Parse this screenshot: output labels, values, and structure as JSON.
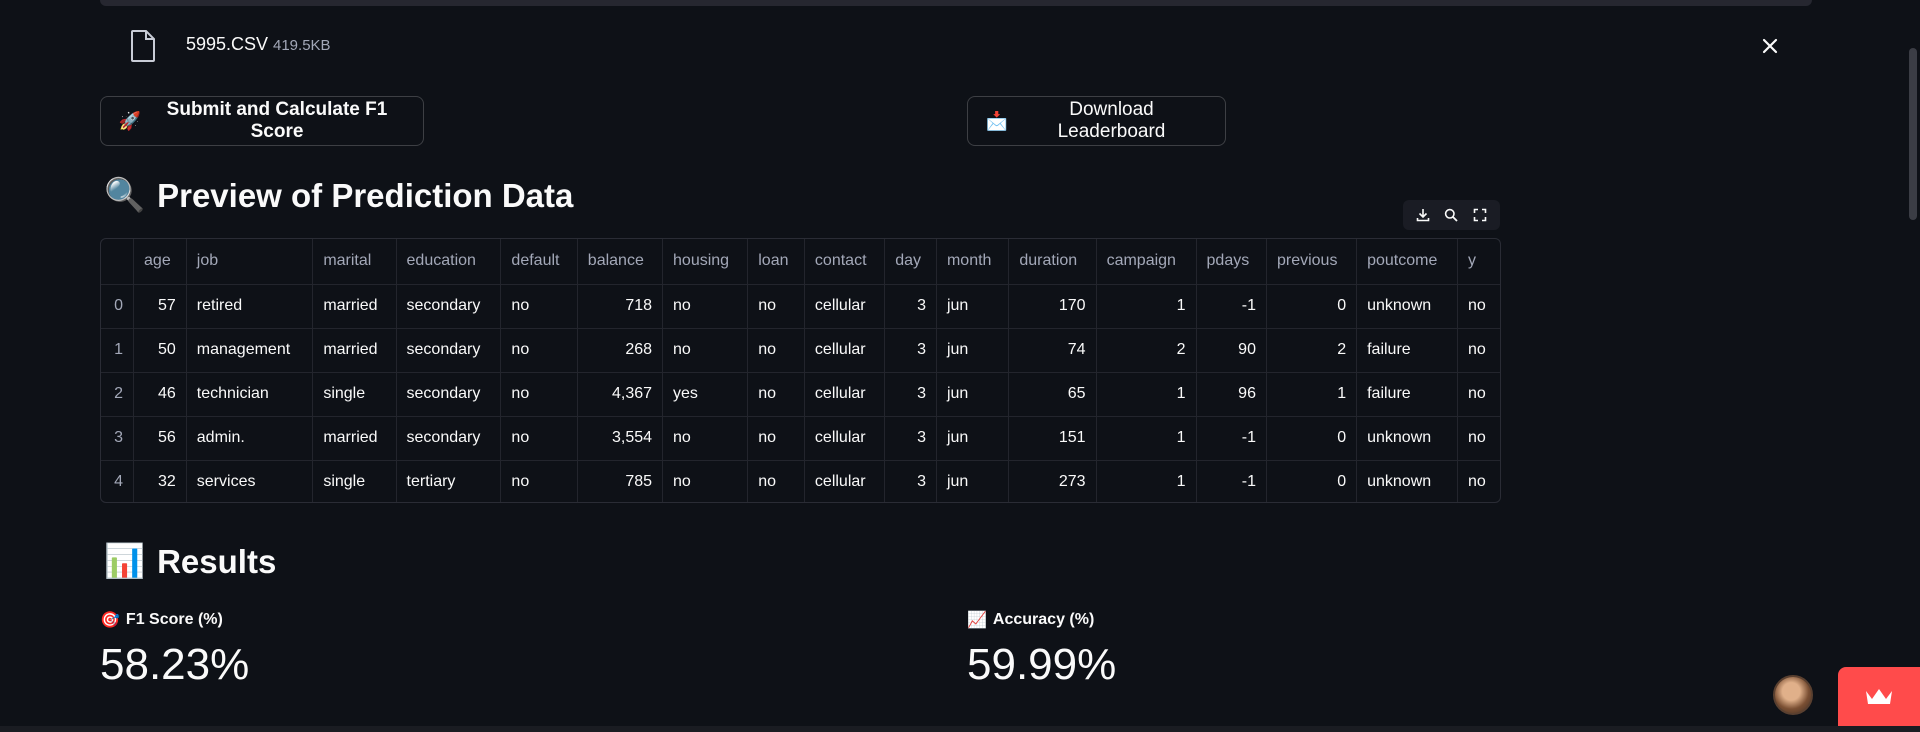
{
  "uploader": {
    "file_name": "5995.CSV",
    "file_size": "419.5KB",
    "file_icon": "file-icon",
    "close_icon": "close-icon"
  },
  "buttons": {
    "submit_emoji": "🚀",
    "submit_label": "Submit and Calculate F1 Score",
    "download_emoji": "📩",
    "download_label": "Download Leaderboard"
  },
  "preview": {
    "emoji": "🔍",
    "title": "Preview of Prediction Data",
    "toolbar_icons": [
      "download-icon",
      "search-icon",
      "fullscreen-icon"
    ],
    "columns": [
      "",
      "age",
      "job",
      "marital",
      "education",
      "default",
      "balance",
      "housing",
      "loan",
      "contact",
      "day",
      "month",
      "duration",
      "campaign",
      "pdays",
      "previous",
      "poutcome",
      "y"
    ],
    "rows": [
      [
        "0",
        "57",
        "retired",
        "married",
        "secondary",
        "no",
        "718",
        "no",
        "no",
        "cellular",
        "3",
        "jun",
        "170",
        "1",
        "-1",
        "0",
        "unknown",
        "no"
      ],
      [
        "1",
        "50",
        "management",
        "married",
        "secondary",
        "no",
        "268",
        "no",
        "no",
        "cellular",
        "3",
        "jun",
        "74",
        "2",
        "90",
        "2",
        "failure",
        "no"
      ],
      [
        "2",
        "46",
        "technician",
        "single",
        "secondary",
        "no",
        "4,367",
        "yes",
        "no",
        "cellular",
        "3",
        "jun",
        "65",
        "1",
        "96",
        "1",
        "failure",
        "no"
      ],
      [
        "3",
        "56",
        "admin.",
        "married",
        "secondary",
        "no",
        "3,554",
        "no",
        "no",
        "cellular",
        "3",
        "jun",
        "151",
        "1",
        "-1",
        "0",
        "unknown",
        "no"
      ],
      [
        "4",
        "32",
        "services",
        "single",
        "tertiary",
        "no",
        "785",
        "no",
        "no",
        "cellular",
        "3",
        "jun",
        "273",
        "1",
        "-1",
        "0",
        "unknown",
        "no"
      ]
    ]
  },
  "results": {
    "emoji": "📊",
    "title": "Results",
    "f1": {
      "emoji": "🎯",
      "label": "F1 Score (%)",
      "value": "58.23%"
    },
    "accuracy": {
      "emoji": "📈",
      "label": "Accuracy (%)",
      "value": "59.99%"
    }
  },
  "colors": {
    "background": "#0e1117",
    "text": "#fafafa",
    "muted": "#a3a8b8",
    "badge": "#ff4b4b"
  }
}
